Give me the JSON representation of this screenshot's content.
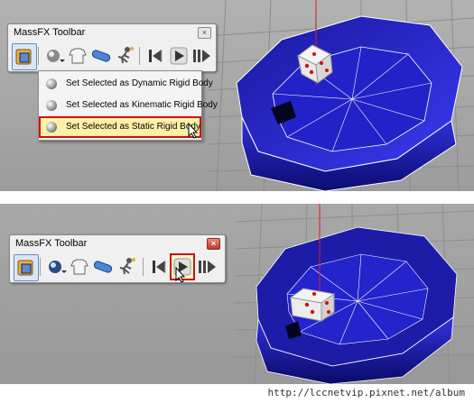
{
  "top_panel": {
    "toolbar": {
      "title": "MassFX Toolbar",
      "close_glyph": "×",
      "icons": [
        "mass-fx-tools-icon",
        "rigid-body-sphere-icon",
        "cloth-shirt-icon",
        "constraint-capsule-icon",
        "ragdoll-figure-icon",
        "reset-simulation-icon",
        "play-simulation-icon",
        "step-simulation-icon"
      ]
    },
    "menu": {
      "items": [
        {
          "label": "Set Selected as Dynamic Rigid Body",
          "highlighted": false
        },
        {
          "label": "Set Selected as Kinematic Rigid Body",
          "highlighted": false
        },
        {
          "label": "Set Selected as Static Rigid Body",
          "highlighted": true
        }
      ]
    }
  },
  "bottom_panel": {
    "toolbar": {
      "title": "MassFX Toolbar",
      "close_glyph": "×",
      "highlighted_icon": "play-simulation-icon"
    }
  },
  "watermark": "http://lccnetvip.pixnet.net/album",
  "colors": {
    "viewport_bg": "#a9a9a9",
    "bowl_blue": "#2b2bd6",
    "highlight_red": "#d01010",
    "menu_highlight": "#fdf0a8"
  }
}
